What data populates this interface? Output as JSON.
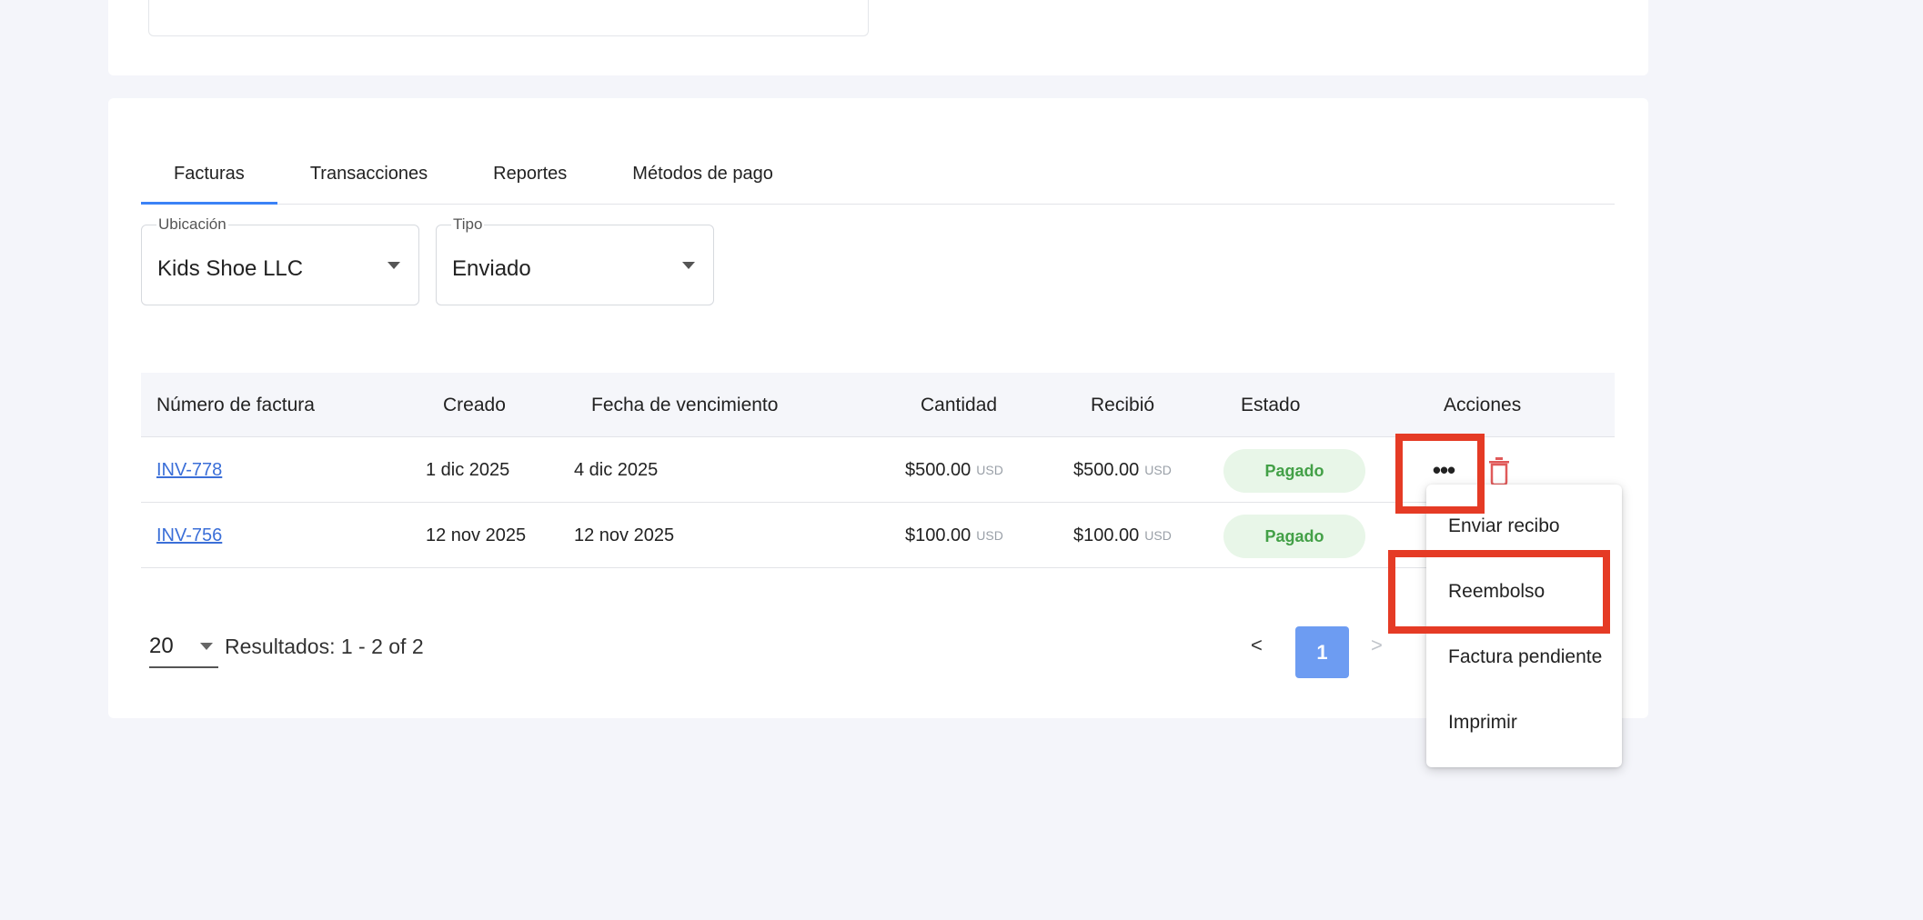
{
  "tabs": [
    {
      "label": "Facturas",
      "active": true
    },
    {
      "label": "Transacciones",
      "active": false
    },
    {
      "label": "Reportes",
      "active": false
    },
    {
      "label": "Métodos de pago",
      "active": false
    }
  ],
  "filters": {
    "location": {
      "label": "Ubicación",
      "value": "Kids Shoe LLC"
    },
    "type": {
      "label": "Tipo",
      "value": "Enviado"
    }
  },
  "table": {
    "headers": {
      "invoice": "Número de factura",
      "created": "Creado",
      "due": "Fecha de vencimiento",
      "amount": "Cantidad",
      "received": "Recibió",
      "status": "Estado",
      "actions": "Acciones"
    },
    "rows": [
      {
        "invoice": "INV-778",
        "created": "1 dic 2025",
        "due": "4 dic 2025",
        "amount": "$500.00",
        "amount_currency": "USD",
        "received": "$500.00",
        "received_currency": "USD",
        "status": "Pagado",
        "more": "•••"
      },
      {
        "invoice": "INV-756",
        "created": "12 nov 2025",
        "due": "12 nov 2025",
        "amount": "$100.00",
        "amount_currency": "USD",
        "received": "$100.00",
        "received_currency": "USD",
        "status": "Pagado"
      }
    ]
  },
  "pagination": {
    "page_size": "20",
    "results": "Resultados: 1 - 2 of 2",
    "prev": "<",
    "current_page": "1",
    "next": ">"
  },
  "actions_menu": {
    "items": [
      "Enviar recibo",
      "Reembolso",
      "Factura pendiente",
      "Imprimir"
    ]
  },
  "colors": {
    "accent": "#3b82f6",
    "link": "#3b6fd8",
    "status_paid_bg": "#e8f6e8",
    "status_paid_text": "#43a047",
    "page_active": "#6d9cf2",
    "highlight": "#e53b25",
    "trash": "#e05a5a"
  },
  "icons": {
    "more": "more-horizontal-icon",
    "delete": "trash-icon",
    "dropdown": "caret-down-icon"
  }
}
